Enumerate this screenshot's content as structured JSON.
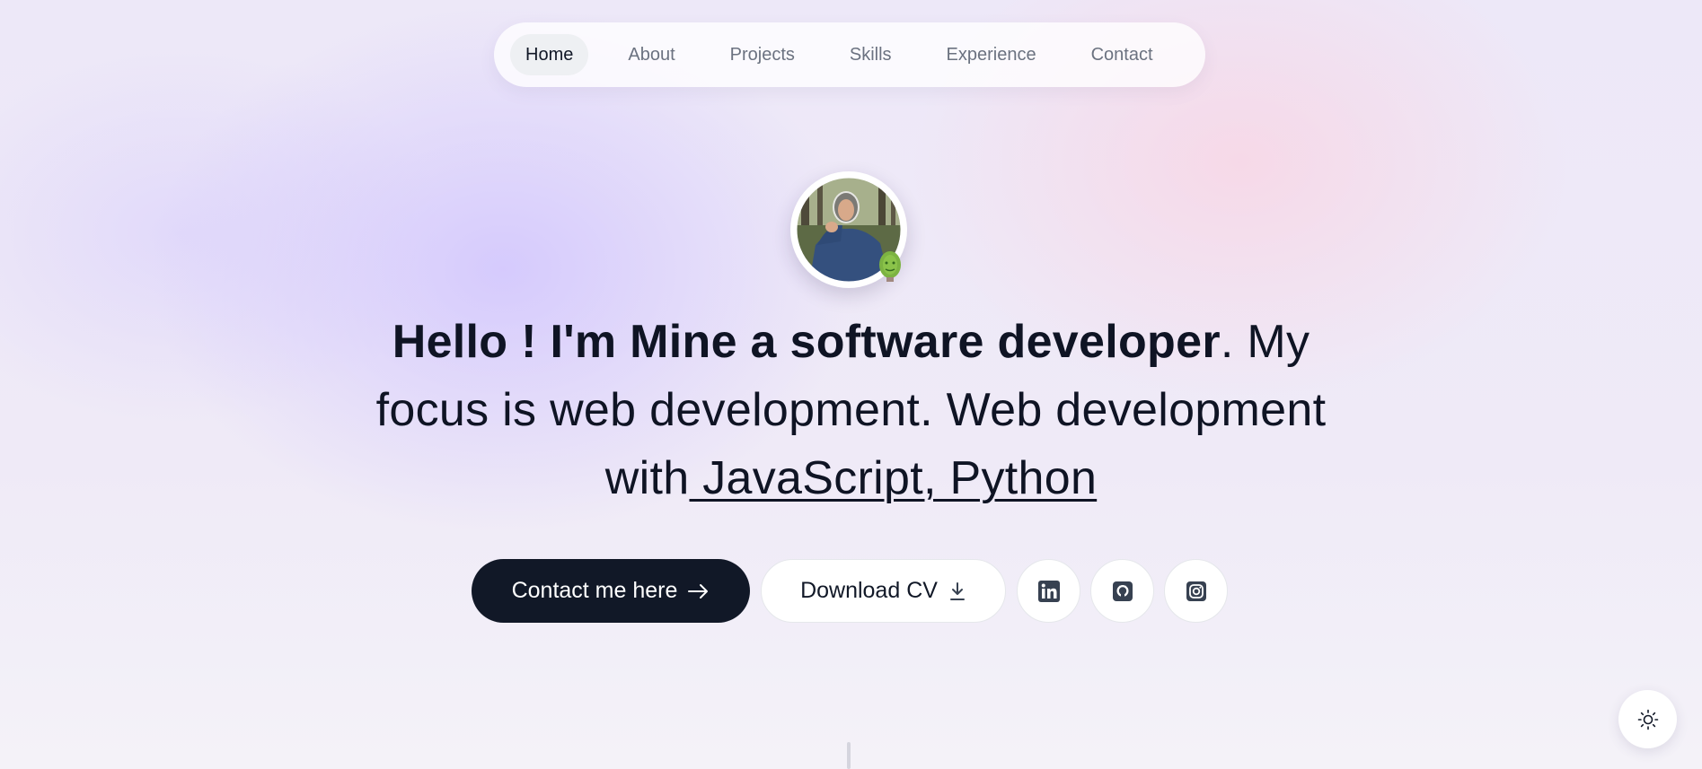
{
  "nav": {
    "items": [
      {
        "label": "Home",
        "active": true
      },
      {
        "label": "About",
        "active": false
      },
      {
        "label": "Projects",
        "active": false
      },
      {
        "label": "Skills",
        "active": false
      },
      {
        "label": "Experience",
        "active": false
      },
      {
        "label": "Contact",
        "active": false
      }
    ]
  },
  "hero": {
    "headline_bold": "Hello ! I'm Mine a software developer",
    "headline_rest": ". My focus is web development. Web development with",
    "headline_tech": " JavaScript, Python"
  },
  "actions": {
    "contact_label": "Contact me here",
    "contact_icon": "arrow-right-icon",
    "download_label": "Download CV",
    "download_icon": "download-icon"
  },
  "social": [
    {
      "icon": "linkedin-icon"
    },
    {
      "icon": "github-icon"
    },
    {
      "icon": "instagram-icon"
    }
  ],
  "theme_toggle": {
    "icon": "sun-icon"
  },
  "colors": {
    "primary_button": "#111827",
    "text": "#0f1424",
    "nav_inactive": "#6b7280",
    "icon_dark": "#374151"
  }
}
